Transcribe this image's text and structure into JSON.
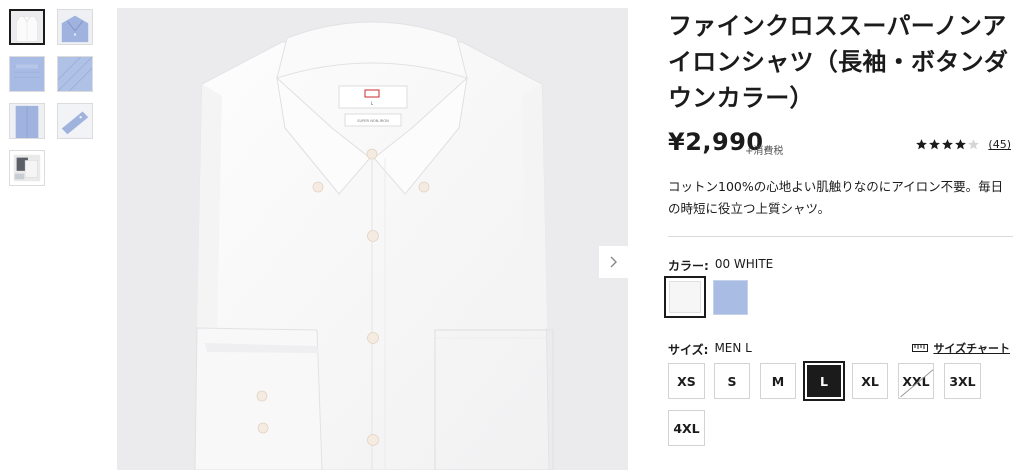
{
  "product": {
    "title": "ファインクロススーパーノンアイロンシャツ（長袖・ボタンダウンカラー）",
    "price": "¥2,990",
    "tax_note": "+消費税",
    "rating": {
      "stars": 4,
      "max_stars": 5,
      "review_count": "(45)"
    },
    "description": "コットン100%の心地よい肌触りなのにアイロン不要。毎日の時短に役立つ上質シャツ。",
    "shirt_label_text": "SUPER NON-IRON",
    "shirt_size_tag": "L"
  },
  "color": {
    "label": "カラー:",
    "selected": "00 WHITE",
    "swatches": [
      {
        "name": "WHITE",
        "hex": "#f6f6f6"
      },
      {
        "name": "BLUE",
        "hex": "#a9bce3"
      }
    ]
  },
  "size": {
    "label": "サイズ:",
    "selected": "MEN L",
    "chart_link": "サイズチャート",
    "options": [
      "XS",
      "S",
      "M",
      "L",
      "XL",
      "XXL",
      "3XL",
      "4XL"
    ],
    "selected_option": "L",
    "unavailable": [
      "XXL"
    ]
  },
  "icons": {
    "next": "chevron-right-icon",
    "ruler": "ruler-icon",
    "star": "star-icon"
  },
  "colors": {
    "text": "#1b1b1b",
    "image_bg": "#ebebed",
    "swatch_blue": "#a9bce3"
  }
}
